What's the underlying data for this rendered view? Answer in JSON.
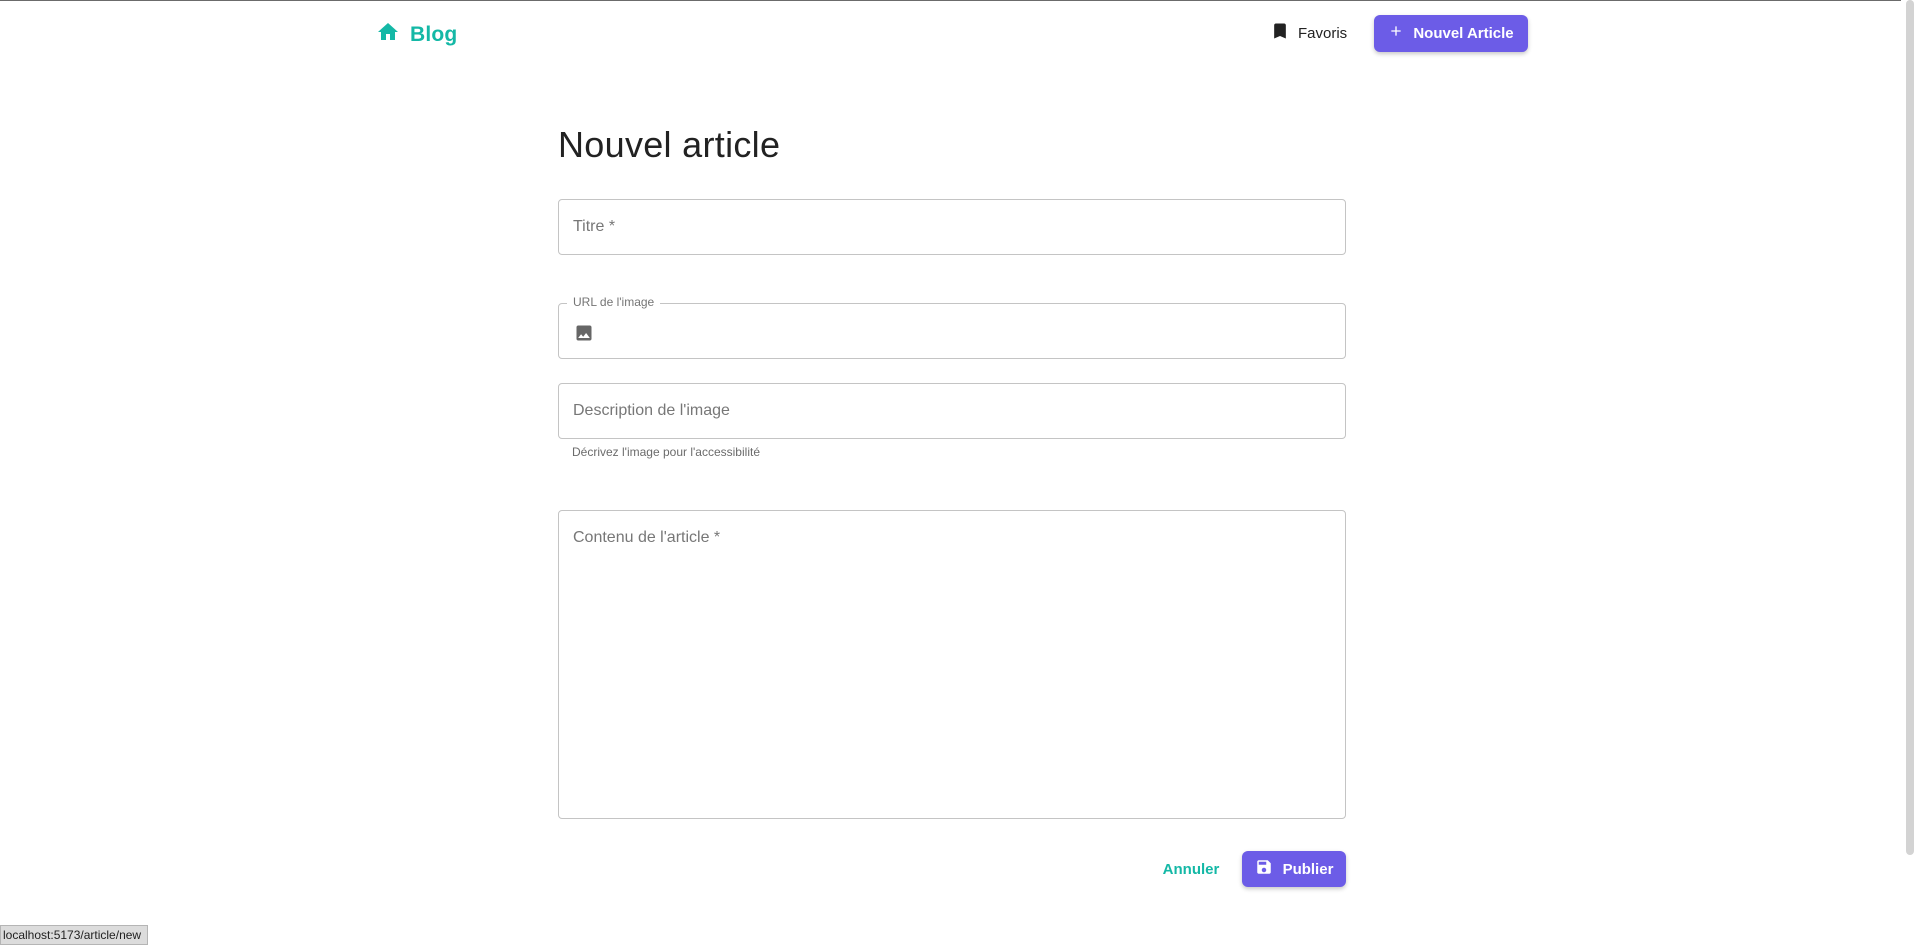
{
  "header": {
    "brand_label": "Blog",
    "brand_icon": "home-icon",
    "favorites_label": "Favoris",
    "favorites_icon": "bookmark-icon",
    "new_article_label": "Nouvel Article",
    "new_article_icon": "plus-icon"
  },
  "form": {
    "page_title": "Nouvel article",
    "title_field": {
      "placeholder": "Titre *",
      "value": ""
    },
    "image_url_field": {
      "label": "URL de l'image",
      "value": "",
      "icon": "image-icon"
    },
    "image_description_field": {
      "placeholder": "Description de l'image",
      "value": "",
      "helper_text": "Décrivez l'image pour l'accessibilité"
    },
    "content_field": {
      "placeholder": "Contenu de l'article *",
      "value": ""
    },
    "cancel_label": "Annuler",
    "publish_label": "Publier",
    "publish_icon": "save-icon"
  },
  "status_bar": {
    "url": "localhost:5173/article/new"
  },
  "colors": {
    "brand": "#14b8a6",
    "primary": "#6c5ce7",
    "border": "#c4c4c4",
    "text": "#222222"
  }
}
